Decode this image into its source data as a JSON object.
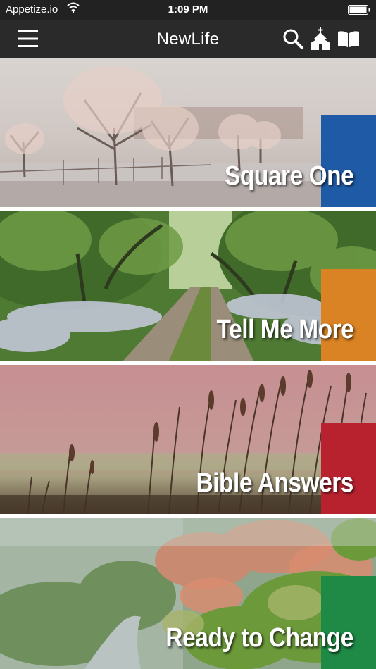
{
  "status_bar": {
    "carrier": "Appetize.io",
    "time": "1:09 PM",
    "wifi_icon": "wifi-icon",
    "battery_icon": "battery-icon"
  },
  "nav": {
    "title": "NewLife",
    "icons": [
      "hamburger-menu-icon",
      "search-icon",
      "church-icon",
      "book-icon"
    ]
  },
  "tiles": [
    {
      "label": "Square One",
      "accent": "#1f5aa6",
      "scene": "frosted winter trees"
    },
    {
      "label": "Tell Me More",
      "accent": "#d98324",
      "scene": "green forest path"
    },
    {
      "label": "Bible Answers",
      "accent": "#b8222f",
      "scene": "reeds at dusk"
    },
    {
      "label": "Ready to Change",
      "accent": "#1f8a46",
      "scene": "misty autumn river valley"
    }
  ]
}
